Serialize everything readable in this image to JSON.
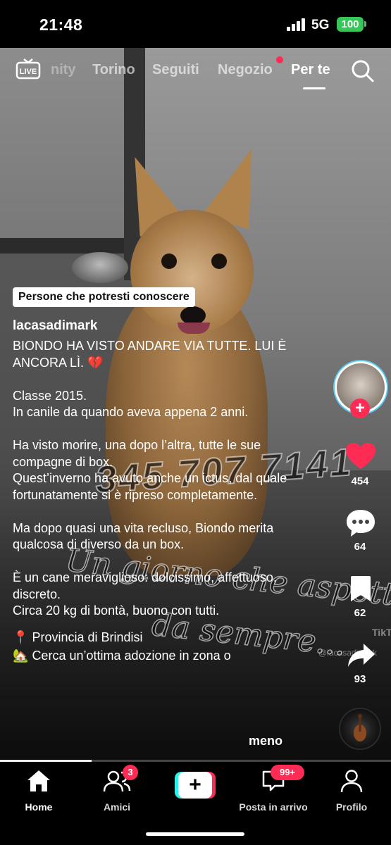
{
  "status_bar": {
    "time": "21:48",
    "network": "5G",
    "battery": "100"
  },
  "top_nav": {
    "live_label": "LIVE",
    "tabs": [
      {
        "label": "nity",
        "state": "faded"
      },
      {
        "label": "Torino",
        "state": "inactive"
      },
      {
        "label": "Seguiti",
        "state": "inactive"
      },
      {
        "label": "Negozio",
        "state": "inactive",
        "has_dot": true
      },
      {
        "label": "Per te",
        "state": "active"
      }
    ]
  },
  "video_overlay": {
    "phone_text": "345 707 7141",
    "script_line1": "Un giorno che aspetta",
    "script_line2": "da sempre...",
    "watermark": "TikTok",
    "watermark_user": "@lacasadimark"
  },
  "post": {
    "suggestion_label": "Persone che potresti conoscere",
    "username": "lacasadimark",
    "caption_paragraphs": [
      "BIONDO HA VISTO ANDARE VIA TUTTE. LUI È ANCORA LÌ. 💔",
      "Classe 2015.\nIn canile da quando aveva appena 2 anni.",
      "Ha visto morire, una dopo l’altra, tutte le sue compagne di box.\nQuest’inverno ha avuto anche un ictus, dal quale fortunatamente si è ripreso completamente.",
      "Ma dopo quasi una vita recluso, Biondo merita qualcosa di diverso da un box.",
      "È un cane meraviglioso: dolcissimo, affettuoso, discreto.\nCirca 20 kg di bontà, buono con tutti."
    ],
    "location_emoji": "📍",
    "location": "Provincia di Brindisi",
    "adoption_emoji": "🏡",
    "adoption": "Cerca un’ottima adozione in zona o",
    "more_label": "meno"
  },
  "actions": {
    "follow_label": "+",
    "likes": "454",
    "comments": "64",
    "saves": "62",
    "shares": "93"
  },
  "progress": {
    "fraction": 0.235
  },
  "bottom_nav": {
    "home": "Home",
    "friends": "Amici",
    "friends_badge": "3",
    "create": "+",
    "inbox": "Posta in arrivo",
    "inbox_badge": "99+",
    "profile": "Profilo"
  },
  "colors": {
    "accent": "#fe2c55",
    "cyan": "#25f4ee",
    "battery": "#37c759"
  }
}
